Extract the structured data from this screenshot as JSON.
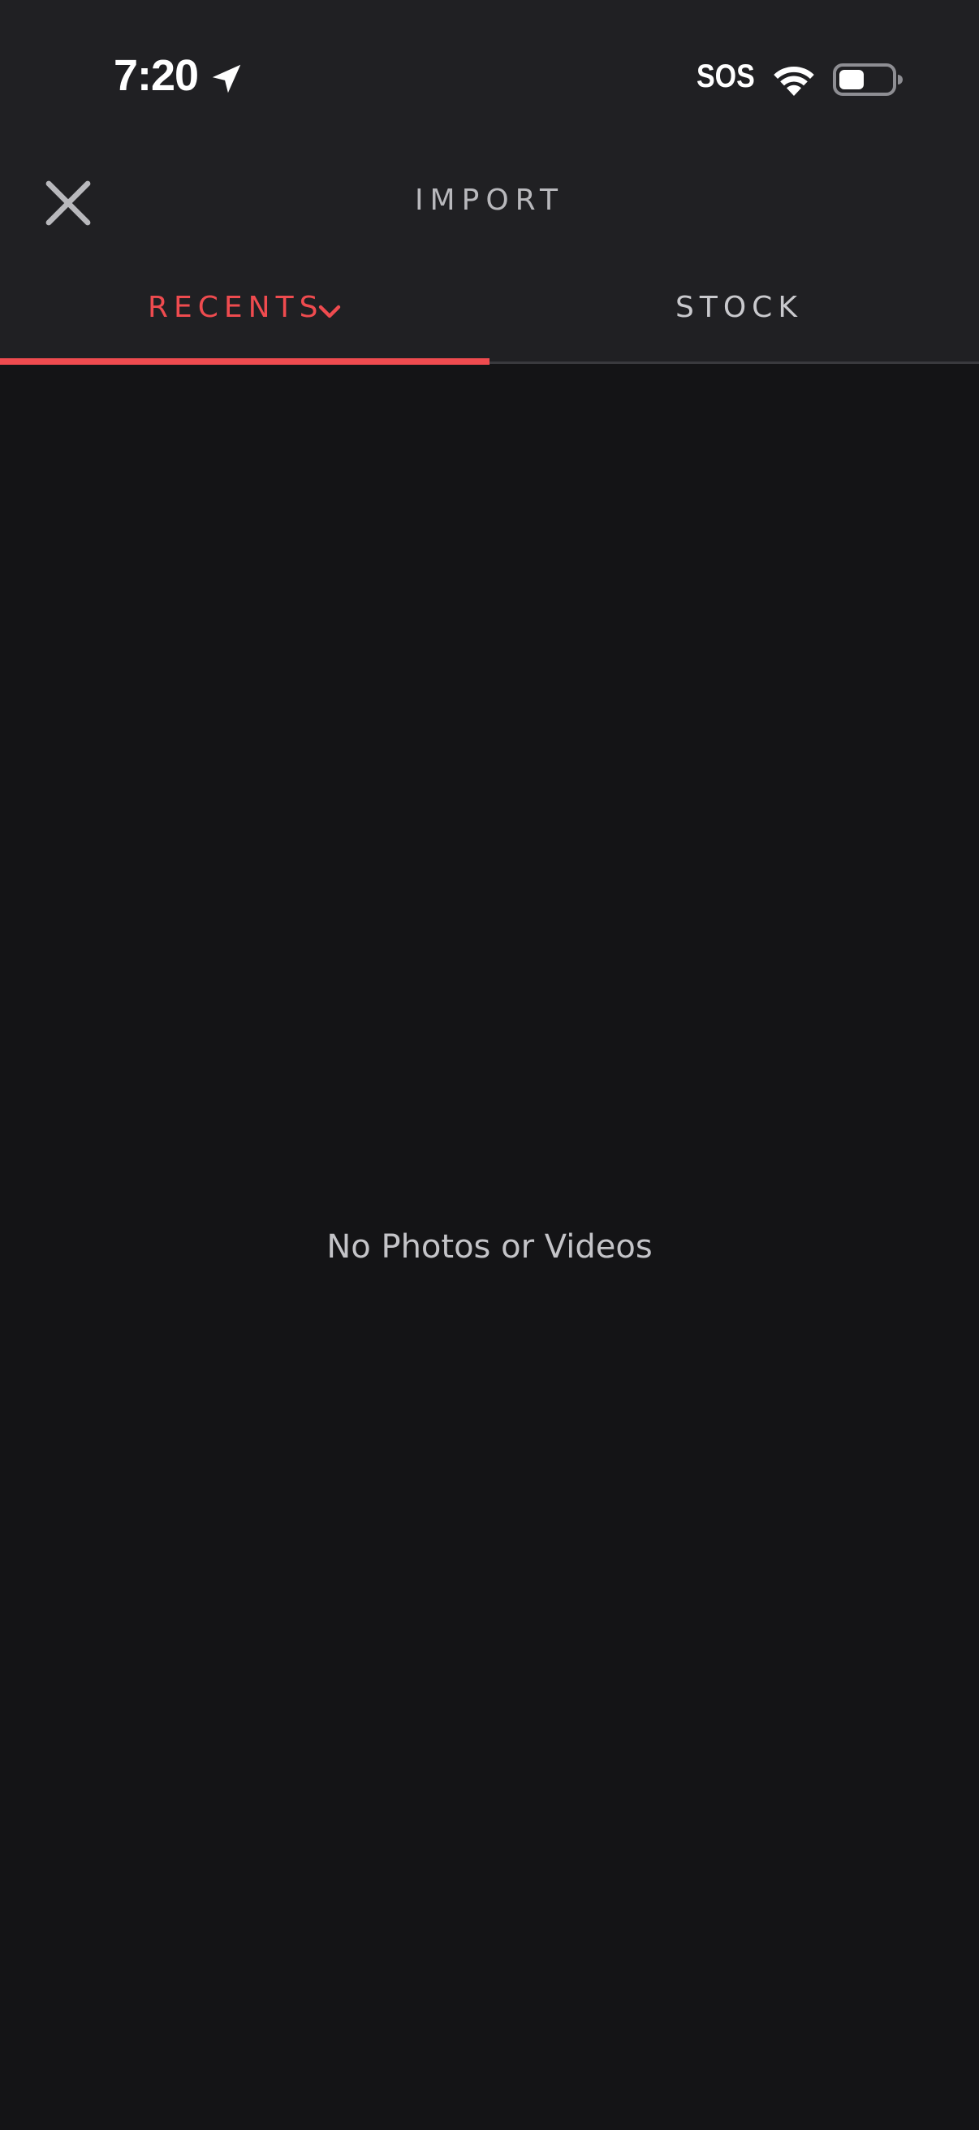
{
  "status_bar": {
    "time": "7:20",
    "sos": "SOS",
    "icons": [
      "location-arrow-icon",
      "wifi-icon",
      "battery-icon"
    ]
  },
  "header": {
    "title": "IMPORT",
    "close_icon": "close-icon"
  },
  "tabs": [
    {
      "label": "RECENTS",
      "active": true,
      "icon": "chevron-down-icon"
    },
    {
      "label": "STOCK",
      "active": false
    }
  ],
  "main": {
    "empty_message": "No Photos or Videos"
  },
  "colors": {
    "accent": "#ef4b4f",
    "header_bg": "#202023",
    "content_bg": "#141416"
  }
}
